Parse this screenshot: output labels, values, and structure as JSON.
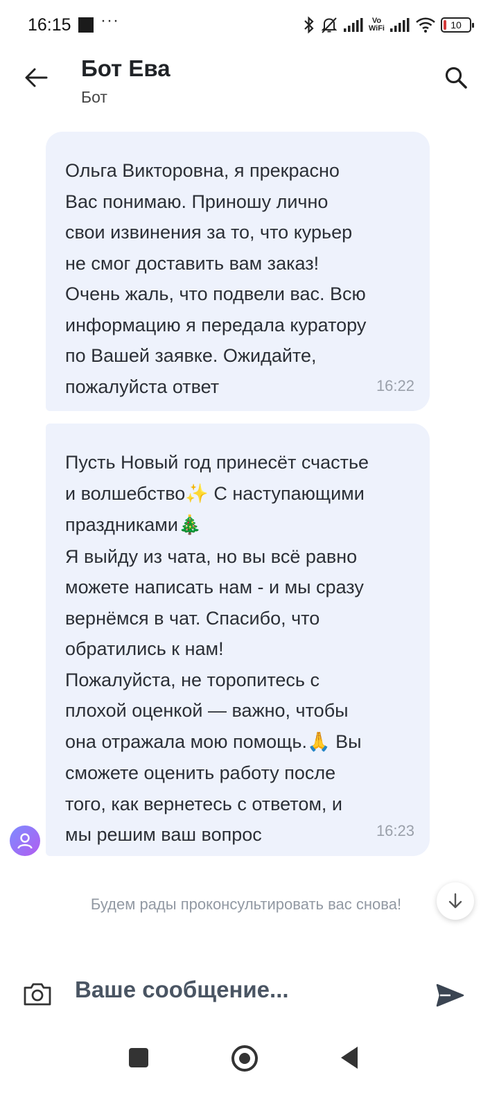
{
  "status_bar": {
    "time": "16:15",
    "more": "···",
    "icons": [
      "bluetooth-icon",
      "bell-off-icon",
      "signal-icon",
      "vowifi-icon",
      "signal-icon",
      "wifi-icon",
      "battery-icon"
    ],
    "vowifi_top": "Vo",
    "vowifi_bottom": "WiFi",
    "battery_level": "10",
    "battery_fraction": 0.1
  },
  "header": {
    "title": "Бот Ева",
    "subtitle": "Бот",
    "back_icon": "arrow-left-icon",
    "search_icon": "search-icon"
  },
  "messages": [
    {
      "text": "Ольга Викторовна, я прекрасно\nВас понимаю. Приношу лично\nсвои извинения за то, что курьер\nне смог доставить вам заказ!\nОчень жаль, что подвели вас. Всю\nинформацию я передала куратору\nпо Вашей заявке. Ожидайте,\nпожалуйста ответ",
      "time": "16:22"
    },
    {
      "line1": "Пусть Новый год принесёт счастье",
      "line2_a": "и волшебство",
      "emoji_sparkles": "✨",
      "line2_b": " С наступающими",
      "line3": "праздниками",
      "emoji_tree": "🎄",
      "body": "Я выйду из чата, но вы всё равно\nможете написать нам - и мы сразу\nвернёмся в чат. Спасибо, что\nобратились к нам!\nПожалуйста, не торопитесь с\nплохой оценкой — важно, чтобы",
      "line_pray_a": "она отражала мою помощь.",
      "emoji_pray": "🙏",
      "line_pray_b": " Вы",
      "tail": "сможете оценить работу после\nтого, как вернетесь с ответом, и\nмы решим ваш вопрос",
      "time": "16:23"
    }
  ],
  "system_note": "Будем рады проконсультировать вас снова!",
  "composer": {
    "placeholder": "Ваше сообщение...",
    "camera_icon": "camera-icon",
    "send_icon": "send-icon"
  },
  "nav_bar": {
    "icons": [
      "recent-apps-icon",
      "home-icon",
      "back-triangle-icon"
    ]
  },
  "colors": {
    "bubble": "#eef2fc",
    "timestamp": "#9aa0aa",
    "avatar_gradient_start": "#7d8cff",
    "avatar_gradient_end": "#b25cf0",
    "battery_low": "#d23b3b"
  }
}
